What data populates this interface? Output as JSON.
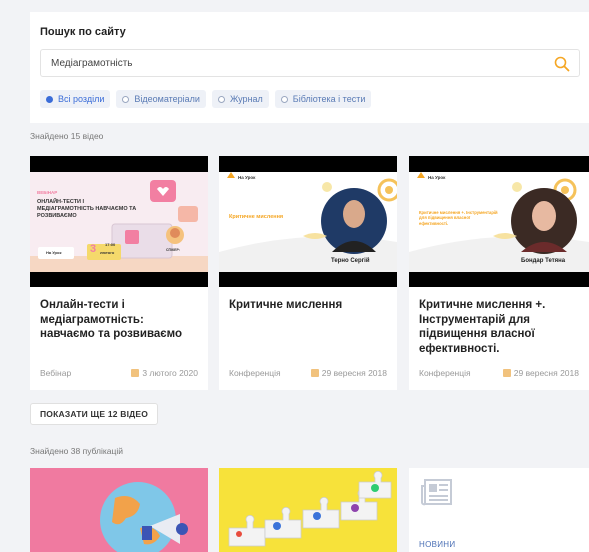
{
  "search": {
    "title": "Пошук по сайту",
    "query": "Медіаграмотність",
    "filters": [
      {
        "label": "Всі розділи",
        "active": true
      },
      {
        "label": "Відеоматеріали",
        "active": false
      },
      {
        "label": "Журнал",
        "active": false
      },
      {
        "label": "Бібліотека і тести",
        "active": false
      }
    ]
  },
  "videos": {
    "found_text": "Знайдено 15 відео",
    "items": [
      {
        "title": "Онлайн-тести і медіаграмотність: навчаємо та розвиваємо",
        "type": "Вебінар",
        "date": "3 лютого 2020",
        "thumb": {
          "kicker": "ВЕБІНАР",
          "headline": "ОНЛАЙН-ТЕСТИ І МЕДІАГРАМОТНІСТЬ НАВЧАЄМО ТА РОЗВИВАЄМО",
          "logo": "На Урок",
          "day": "3",
          "month": "лютого",
          "time": "17:00",
          "speaker_label": "СПІКЕР:"
        }
      },
      {
        "title": "Критичне мислення",
        "type": "Конференція",
        "date": "29 вересня 2018",
        "thumb": {
          "logo": "На Урок",
          "subtitle": "Критичне мислення",
          "person": "Терно Сергій"
        }
      },
      {
        "title": "Критичне мислення +. Інструментарій для підвищення власної ефективності.",
        "type": "Конференція",
        "date": "29 вересня 2018",
        "thumb": {
          "logo": "На Урок",
          "subtitle": "Критичне мислення +. Інструментарій для підвищення власної ефективності.",
          "person": "Бондар Тетяна"
        }
      }
    ],
    "more_button": "ПОКАЗАТИ ЩЕ 12 ВІДЕО"
  },
  "publications": {
    "found_text": "Знайдено 38 публікацій",
    "items": [
      {
        "tag": ""
      },
      {
        "tag": ""
      },
      {
        "tag": "НОВИНИ"
      }
    ]
  },
  "colors": {
    "accent": "#3b6dd8",
    "orange": "#f5a623",
    "pink": "#f27fa2",
    "yellow": "#f7e23a"
  }
}
